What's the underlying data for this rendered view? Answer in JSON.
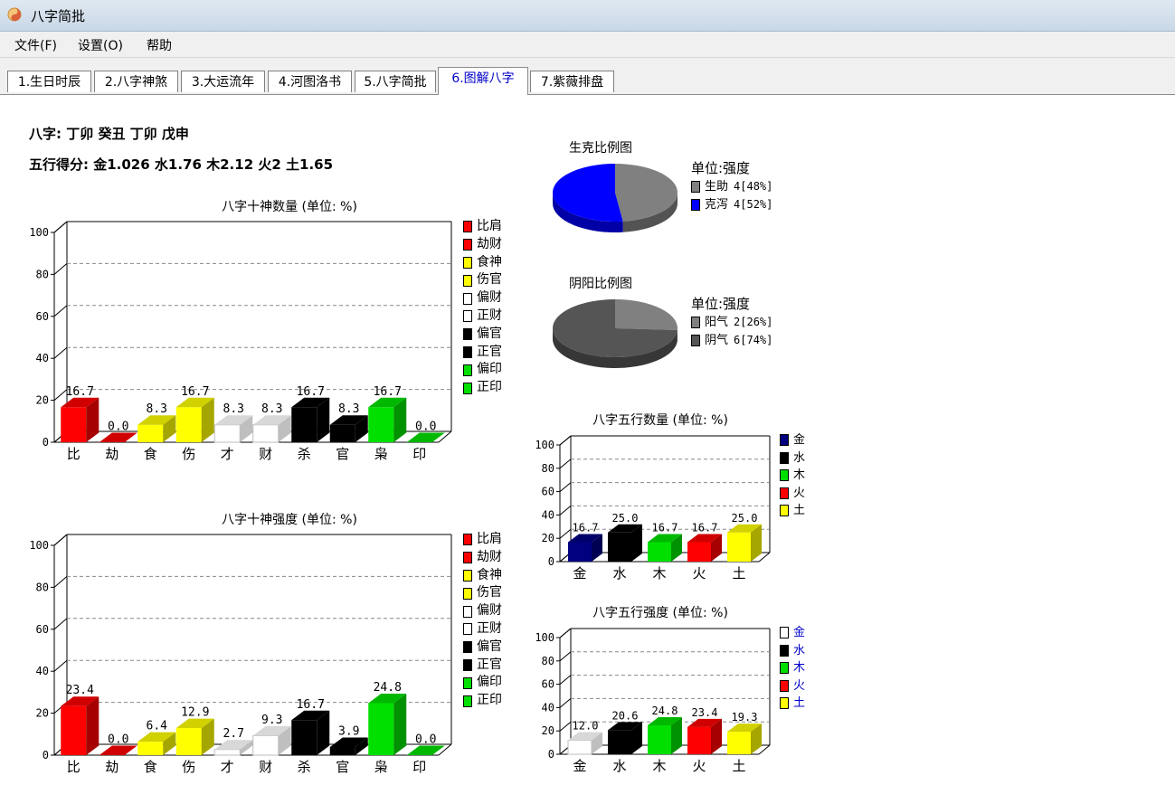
{
  "window": {
    "title": "八字简批"
  },
  "menu": [
    "文件(F)",
    "设置(O)",
    "帮助"
  ],
  "tabs": [
    "1.生日时辰",
    "2.八字神煞",
    "3.大运流年",
    "4.河图洛书",
    "5.八字简批",
    "6.图解八字",
    "7.紫薇排盘"
  ],
  "active_tab": "6.图解八字",
  "bazi": {
    "pillars_line": "八字: 丁卯 癸丑 丁卯 戊申",
    "wuxing_score_line": "五行得分: 金1.026 水1.76 木2.12 火2 土1.65"
  },
  "colors": {
    "red": "#ff0000",
    "yellow": "#ffff00",
    "white": "#ffffff",
    "black": "#000000",
    "green": "#00e000",
    "navy": "#000080",
    "blue": "#0000ff",
    "gray_light": "#808080",
    "gray_dark": "#555555"
  },
  "chart_data": [
    {
      "id": "shishen-count",
      "type": "bar",
      "title": "八字十神数量 (单位: %)",
      "categories": [
        "比",
        "劫",
        "食",
        "伤",
        "才",
        "财",
        "杀",
        "官",
        "枭",
        "印"
      ],
      "values": [
        16.7,
        0.0,
        8.3,
        16.7,
        8.3,
        8.3,
        16.7,
        8.3,
        16.7,
        0.0
      ],
      "value_labels": [
        "16.7",
        "0.0",
        "8.3",
        "16.7",
        "8.3",
        "8.3",
        "16.7",
        "8.3",
        "16.7",
        "0.0"
      ],
      "colors": [
        "red",
        "red",
        "yellow",
        "yellow",
        "white",
        "white",
        "black",
        "black",
        "green",
        "green"
      ],
      "ylim": [
        0,
        100
      ],
      "yticks": [
        "0",
        "20",
        "40",
        "60",
        "80",
        "100"
      ],
      "legend": [
        {
          "label": "比肩",
          "color": "red"
        },
        {
          "label": "劫财",
          "color": "red"
        },
        {
          "label": "食神",
          "color": "yellow"
        },
        {
          "label": "伤官",
          "color": "yellow"
        },
        {
          "label": "偏财",
          "color": "white"
        },
        {
          "label": "正财",
          "color": "white"
        },
        {
          "label": "偏官",
          "color": "black"
        },
        {
          "label": "正官",
          "color": "black"
        },
        {
          "label": "偏印",
          "color": "green"
        },
        {
          "label": "正印",
          "color": "green"
        }
      ],
      "legend_placement": "right",
      "grid": true
    },
    {
      "id": "shishen-strength",
      "type": "bar",
      "title": "八字十神强度 (单位: %)",
      "categories": [
        "比",
        "劫",
        "食",
        "伤",
        "才",
        "财",
        "杀",
        "官",
        "枭",
        "印"
      ],
      "values": [
        23.4,
        0.0,
        6.4,
        12.9,
        2.7,
        9.3,
        16.7,
        3.9,
        24.8,
        0.0
      ],
      "value_labels": [
        "23.4",
        "0.0",
        "6.4",
        "12.9",
        "2.7",
        "9.3",
        "16.7",
        "3.9",
        "24.8",
        "0.0"
      ],
      "colors": [
        "red",
        "red",
        "yellow",
        "yellow",
        "white",
        "white",
        "black",
        "black",
        "green",
        "green"
      ],
      "ylim": [
        0,
        100
      ],
      "yticks": [
        "0",
        "20",
        "40",
        "60",
        "80",
        "100"
      ],
      "legend": [
        {
          "label": "比肩",
          "color": "red"
        },
        {
          "label": "劫财",
          "color": "red"
        },
        {
          "label": "食神",
          "color": "yellow"
        },
        {
          "label": "伤官",
          "color": "yellow"
        },
        {
          "label": "偏财",
          "color": "white"
        },
        {
          "label": "正财",
          "color": "white"
        },
        {
          "label": "偏官",
          "color": "black"
        },
        {
          "label": "正官",
          "color": "black"
        },
        {
          "label": "偏印",
          "color": "green"
        },
        {
          "label": "正印",
          "color": "green"
        }
      ],
      "legend_placement": "right",
      "grid": true
    },
    {
      "id": "wuxing-count",
      "type": "bar",
      "title": "八字五行数量 (单位: %)",
      "categories": [
        "金",
        "水",
        "木",
        "火",
        "土"
      ],
      "values": [
        16.7,
        25.0,
        16.7,
        16.7,
        25.0
      ],
      "value_labels": [
        "16.7",
        "25.0",
        "16.7",
        "16.7",
        "25.0"
      ],
      "colors": [
        "navy",
        "black",
        "green",
        "red",
        "yellow"
      ],
      "ylim": [
        0,
        100
      ],
      "yticks": [
        "0",
        "20",
        "40",
        "60",
        "80",
        "100"
      ],
      "legend": [
        {
          "label": "金",
          "color": "navy"
        },
        {
          "label": "水",
          "color": "black"
        },
        {
          "label": "木",
          "color": "green"
        },
        {
          "label": "火",
          "color": "red"
        },
        {
          "label": "土",
          "color": "yellow"
        }
      ],
      "legend_placement": "right",
      "grid": true
    },
    {
      "id": "wuxing-strength",
      "type": "bar",
      "title": "八字五行强度 (单位: %)",
      "categories": [
        "金",
        "水",
        "木",
        "火",
        "土"
      ],
      "values": [
        12.0,
        20.6,
        24.8,
        23.4,
        19.3
      ],
      "value_labels": [
        "12.0",
        "20.6",
        "24.8",
        "23.4",
        "19.3"
      ],
      "colors": [
        "white",
        "black",
        "green",
        "red",
        "yellow"
      ],
      "ylim": [
        0,
        100
      ],
      "yticks": [
        "0",
        "20",
        "40",
        "60",
        "80",
        "100"
      ],
      "legend": [
        {
          "label": "金",
          "color": "white"
        },
        {
          "label": "水",
          "color": "black"
        },
        {
          "label": "木",
          "color": "green"
        },
        {
          "label": "火",
          "color": "red"
        },
        {
          "label": "土",
          "color": "yellow"
        }
      ],
      "legend_placement": "right",
      "grid": true
    },
    {
      "id": "shengke",
      "type": "pie",
      "title": "生克比例图",
      "unit_label": "单位:强度",
      "slices": [
        {
          "label": "生助",
          "count": 4,
          "percent": 48,
          "text": "4[48%]",
          "color": "gray_light"
        },
        {
          "label": "克泻",
          "count": 4,
          "percent": 52,
          "text": "4[52%]",
          "color": "blue"
        }
      ],
      "legend_placement": "right"
    },
    {
      "id": "yinyang",
      "type": "pie",
      "title": "阴阳比例图",
      "unit_label": "单位:强度",
      "slices": [
        {
          "label": "阳气",
          "count": 2,
          "percent": 26,
          "text": "2[26%]",
          "color": "gray_light"
        },
        {
          "label": "阴气",
          "count": 6,
          "percent": 74,
          "text": "6[74%]",
          "color": "gray_dark"
        }
      ],
      "legend_placement": "right"
    }
  ]
}
